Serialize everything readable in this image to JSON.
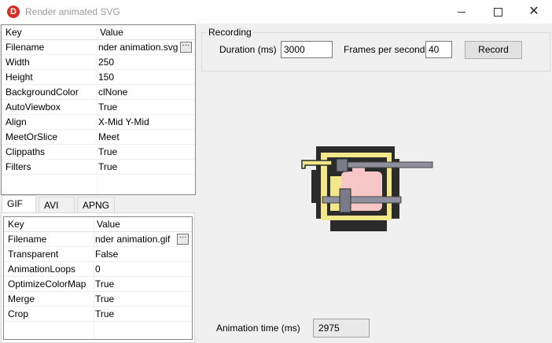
{
  "window": {
    "title": "Render animated SVG",
    "icon_letter": "D",
    "accent": "#d93025",
    "controls": {
      "minimize": "minimize-icon",
      "maximize": "maximize-icon",
      "close": "✕"
    }
  },
  "svg_properties": {
    "headers": {
      "key": "Key",
      "value": "Value"
    },
    "rows": [
      {
        "key": "Filename",
        "value": "nder animation.svg",
        "has_button": true
      },
      {
        "key": "Width",
        "value": "250"
      },
      {
        "key": "Height",
        "value": "150"
      },
      {
        "key": "BackgroundColor",
        "value": "clNone"
      },
      {
        "key": "AutoViewbox",
        "value": "True"
      },
      {
        "key": "Align",
        "value": "X-Mid Y-Mid"
      },
      {
        "key": "MeetOrSlice",
        "value": "Meet"
      },
      {
        "key": "Clippaths",
        "value": "True"
      },
      {
        "key": "Filters",
        "value": "True"
      }
    ]
  },
  "tabs": [
    {
      "label": "GIF",
      "active": true
    },
    {
      "label": "AVI",
      "active": false
    },
    {
      "label": "APNG",
      "active": false
    }
  ],
  "gif_properties": {
    "headers": {
      "key": "Key",
      "value": "Value"
    },
    "rows": [
      {
        "key": "Filename",
        "value": "nder animation.gif",
        "has_button": true
      },
      {
        "key": "Transparent",
        "value": "False"
      },
      {
        "key": "AnimationLoops",
        "value": "0"
      },
      {
        "key": "OptimizeColorMap",
        "value": "True"
      },
      {
        "key": "Merge",
        "value": "True"
      },
      {
        "key": "Crop",
        "value": "True"
      }
    ]
  },
  "recording": {
    "group_label": "Recording",
    "duration_label": "Duration (ms)",
    "duration_value": "3000",
    "fps_label": "Frames per second",
    "fps_value": "40",
    "record_button": "Record"
  },
  "status": {
    "animation_time_label": "Animation time (ms)",
    "animation_time_value": "2975"
  },
  "ellipsis": "···"
}
